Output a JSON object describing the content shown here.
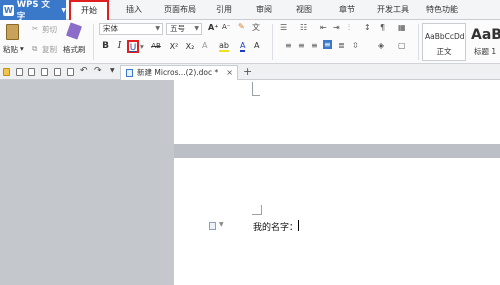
{
  "app": {
    "title": "WPS 文字",
    "logo": "W"
  },
  "menu": {
    "tabs": [
      "开始",
      "插入",
      "页面布局",
      "引用",
      "审阅",
      "视图",
      "章节",
      "开发工具",
      "特色功能"
    ]
  },
  "ribbon": {
    "clipboard": {
      "cut": "剪切",
      "copy": "复制",
      "paste": "粘贴",
      "format_painter": "格式刷"
    },
    "font_name": "宋体",
    "font_size": "五号",
    "grow_font": "A⁺",
    "shrink_font": "A⁻",
    "format": {
      "bold": "B",
      "italic": "I",
      "underline": "U",
      "strike": "AB",
      "superscript": "X²",
      "subscript": "X₂"
    },
    "styles": [
      {
        "preview": "AaBbCcDd",
        "name": "正文"
      },
      {
        "preview": "AaB",
        "name": "标题 1"
      }
    ]
  },
  "document": {
    "tab_label": "新建 Micros...(2).doc *",
    "close": "×",
    "new_tab": "+",
    "text": "我的名字："
  },
  "colors": {
    "accent": "#3a78c9",
    "highlight_border": "#e02020"
  }
}
